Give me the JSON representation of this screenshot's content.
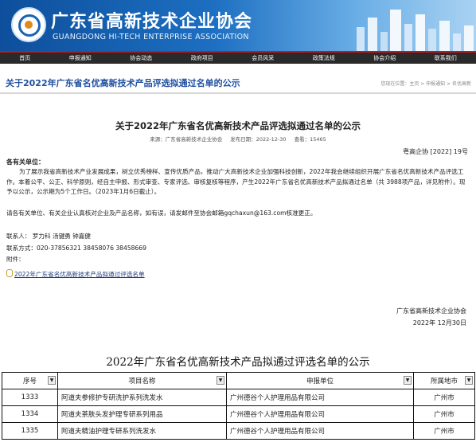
{
  "header": {
    "title_cn": "广东省高新技术企业协会",
    "title_en": "GUANGDONG HI-TECH ENTERPRISE ASSOCIATION"
  },
  "nav": {
    "items": [
      "首页",
      "申报通知",
      "协会动态",
      "政府项目",
      "会员风采",
      "政策法规",
      "协会介绍",
      "联系我们"
    ]
  },
  "page": {
    "title": "关于2022年广东省名优高新技术产品评选拟通过名单的公示",
    "breadcrumb": "您现在位置：主页 > 申报通知 > 名优高新"
  },
  "article": {
    "title": "关于2022年广东省名优高新技术产品评选拟通过名单的公示",
    "source": "来源：广东省高新技术企业协会",
    "date": "发布日期：2022-12-30",
    "views": "查看：15465",
    "doc_no": "粤高企协 [2022] 19号",
    "salutation": "各有关单位：",
    "para1": "为了展示我省高新技术产业发展成果，树立优秀榜样、宣传优质产品，推动广大高新技术企业加强科技创新，2022年我会继续组织开展广东省名优高新技术产品评选工作。本着公平、公正、科学原则，经自主申报、形式审查、专家评选、审核复核等程序，产生2022年广东省名优高新技术产品拟通过名单（共 3988项产品，详见附件）。现予以公示，公示期为5个工作日。（2023年1月6日截止）。",
    "para2": "请各有关单位、有关企业认真核对企业及产品名称，如有误，请发邮件至协会邮箱gqchaxun@163.com核准更正。",
    "contact_people": "联系人：  罗力科  汤键勇  钟嘉健",
    "contact_phone": "联系方式：020-37856321  38458076  38458669",
    "attachment_label": "附件：",
    "attachment_link": "2022年广东省名优高新技术产品拟通过评选名单",
    "sign_org": "广东省高新技术企业协会",
    "sign_date": "2022年 12月30日"
  },
  "sheet": {
    "title": "2022年广东省名优高新技术产品拟通过评选名单的公示",
    "headers": [
      "序号",
      "项目名称",
      "申报单位",
      "所属地市"
    ],
    "rows": [
      [
        "1333",
        "阿道夫参修护专研洗护系列洗发水",
        "广州德谷个人护理用品有限公司",
        "广州市"
      ],
      [
        "1334",
        "阿道夫茶肤头发护理专研系列用品",
        "广州德谷个人护理用品有限公司",
        "广州市"
      ],
      [
        "1335",
        "阿道夫精油护理专研系列洗发水",
        "广州德谷个人护理用品有限公司",
        "广州市"
      ]
    ]
  },
  "colors": {
    "header_blue": "#0d4f9c",
    "nav_dark": "#2a2a2a",
    "accent_red": "#c9151e",
    "title_blue": "#1f4fa0"
  }
}
